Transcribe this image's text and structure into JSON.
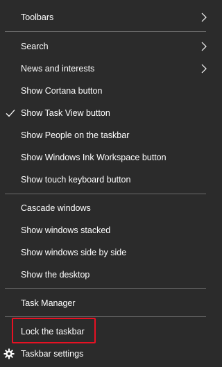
{
  "menu": {
    "items": [
      {
        "label": "Toolbars",
        "submenu": true
      },
      {
        "label": "Search",
        "submenu": true
      },
      {
        "label": "News and interests",
        "submenu": true
      },
      {
        "label": "Show Cortana button"
      },
      {
        "label": "Show Task View button",
        "checked": true
      },
      {
        "label": "Show People on the taskbar"
      },
      {
        "label": "Show Windows Ink Workspace button"
      },
      {
        "label": "Show touch keyboard button"
      },
      {
        "label": "Cascade windows"
      },
      {
        "label": "Show windows stacked"
      },
      {
        "label": "Show windows side by side"
      },
      {
        "label": "Show the desktop"
      },
      {
        "label": "Task Manager"
      },
      {
        "label": "Lock the taskbar",
        "highlighted": true
      },
      {
        "label": "Taskbar settings",
        "icon": "gear-icon"
      }
    ]
  },
  "colors": {
    "background": "#2b2b2b",
    "text": "#ffffff",
    "separator": "#6b6b6b",
    "highlight_border": "#e81123"
  }
}
